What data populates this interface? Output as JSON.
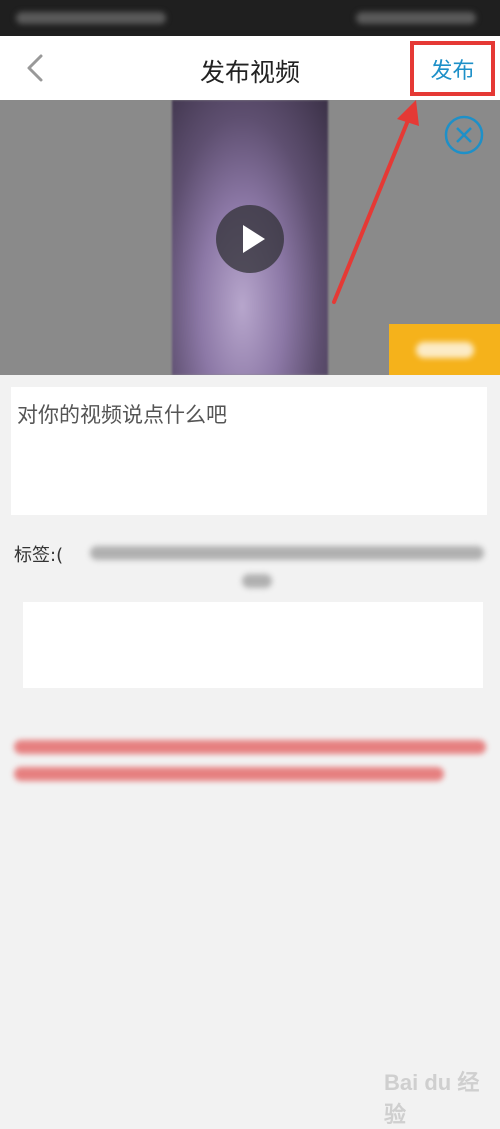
{
  "nav": {
    "title": "发布视频",
    "publish_label": "发布"
  },
  "description": {
    "placeholder": "对你的视频说点什么吧"
  },
  "tags": {
    "label": "标签:("
  },
  "watermark": {
    "text": "Bai du 经验"
  },
  "colors": {
    "accent_blue": "#1e90c8",
    "highlight_red": "#e53935",
    "cover_button": "#f5b21b",
    "warning_text": "#e57373"
  },
  "icons": {
    "back": "chevron-left-icon",
    "close": "circle-x-icon",
    "play": "play-icon"
  }
}
